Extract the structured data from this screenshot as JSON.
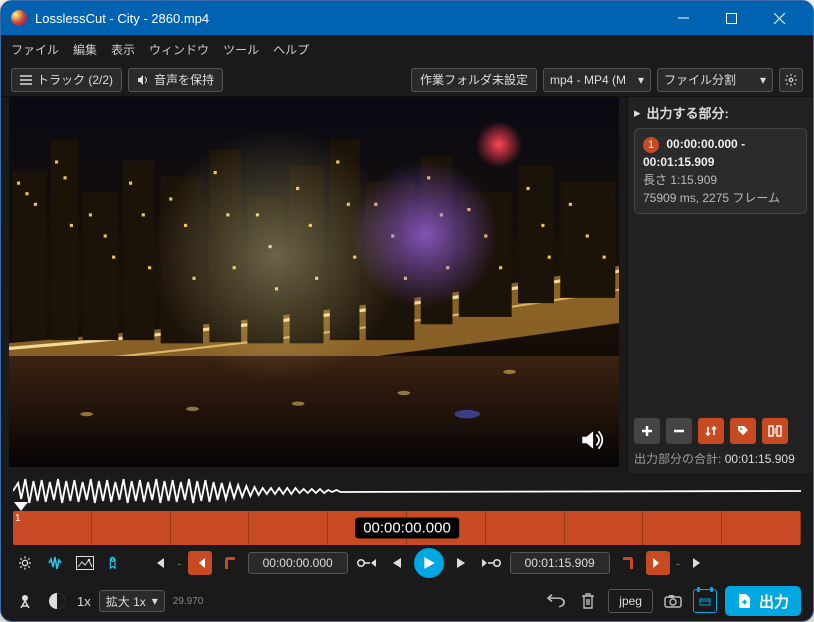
{
  "window": {
    "title": "LosslessCut - City - 2860.mp4"
  },
  "menu": {
    "file": "ファイル",
    "edit": "編集",
    "view": "表示",
    "windowm": "ウィンドウ",
    "tools": "ツール",
    "help": "ヘルプ"
  },
  "toolbar": {
    "tracks_label": "トラック (2/2)",
    "keep_audio_label": "音声を保持",
    "work_folder_label": "作業フォルダ未設定",
    "format_select": "mp4 - MP4 (M",
    "split_select": "ファイル分割"
  },
  "sidepanel": {
    "header": "出力する部分:",
    "segment": {
      "num": "1",
      "range": "00:00:00.000 - 00:01:15.909",
      "length_label": "長さ 1:15.909",
      "detail": "75909 ms, 2275 フレーム"
    },
    "sum_label": "出力部分の合計:",
    "sum_value": "00:01:15.909"
  },
  "timeline": {
    "segment_num": "1",
    "current_time": "00:00:00.000"
  },
  "controls": {
    "start_tc": "00:00:00.000",
    "end_tc": "00:01:15.909"
  },
  "bottom": {
    "speed": "1x",
    "zoom": "拡大 1x",
    "fps": "29.970",
    "format": "jpeg",
    "export": "出力"
  }
}
